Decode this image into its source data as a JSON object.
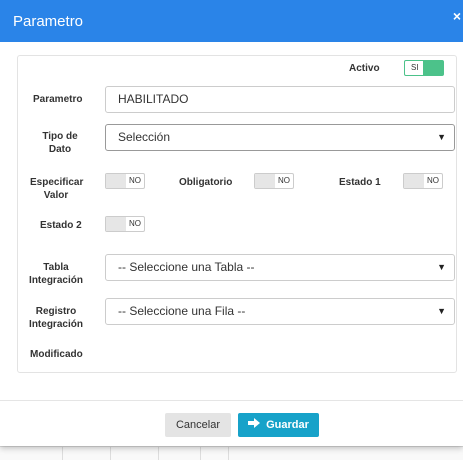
{
  "modal": {
    "title": "Parametro",
    "close_label": "×"
  },
  "form": {
    "activo": {
      "label": "Activo",
      "toggle_text": "SI",
      "state": "on"
    },
    "parametro": {
      "label": "Parametro",
      "value": "HABILITADO"
    },
    "tipo_dato": {
      "label_line1": "Tipo de",
      "label_line2": "Dato",
      "value": "Selección"
    },
    "especificar_valor": {
      "label_line1": "Especificar",
      "label_line2": "Valor",
      "toggle_text": "NO",
      "state": "off"
    },
    "obligatorio": {
      "label": "Obligatorio",
      "toggle_text": "NO",
      "state": "off"
    },
    "estado1": {
      "label": "Estado 1",
      "toggle_text": "NO",
      "state": "off"
    },
    "estado2": {
      "label": "Estado 2",
      "toggle_text": "NO",
      "state": "off"
    },
    "tabla_integracion": {
      "label_line1": "Tabla",
      "label_line2": "Integración",
      "value": "-- Seleccione una Tabla --"
    },
    "registro_integracion": {
      "label_line1": "Registro",
      "label_line2": "Integración",
      "value": "-- Seleccione una Fila --"
    },
    "modificado": {
      "label": "Modificado"
    }
  },
  "footer": {
    "cancel_label": "Cancelar",
    "save_label": "Guardar",
    "save_icon": "save-arrow-icon"
  },
  "colors": {
    "header": "#2a84e8",
    "toggle_on": "#4cc28a",
    "save_button": "#17a2c9"
  }
}
